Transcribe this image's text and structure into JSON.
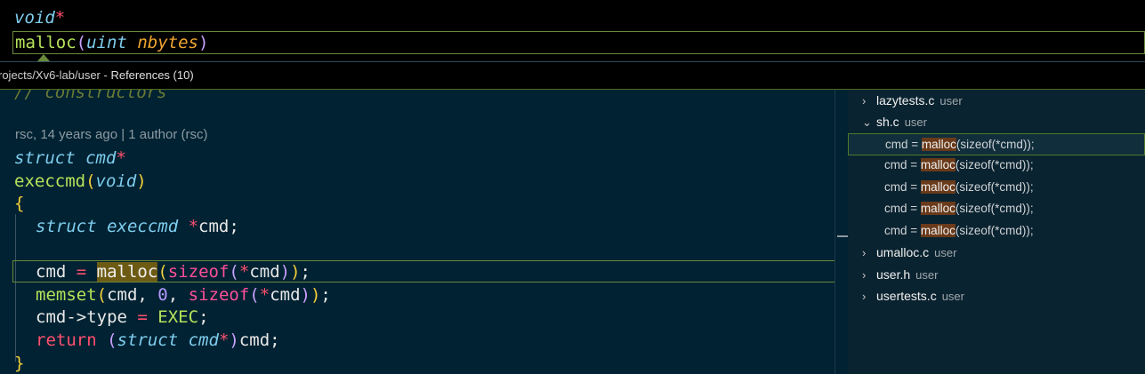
{
  "signature": {
    "return_type": "void",
    "return_ptr": "*",
    "fn_name": "malloc",
    "open_paren": "(",
    "param_type": "uint",
    "param_name": "nbytes",
    "close_paren": ")"
  },
  "peek": {
    "path": "rojects/Xv6-lab/user",
    "separator": " - ",
    "title": "References (10)"
  },
  "code": {
    "cut_line": "// constructors",
    "blame": "rsc, 14 years ago | 1 author (rsc)",
    "lines": {
      "l1_type": "struct cmd",
      "l1_ptr": "*",
      "l2_fn": "execcmd",
      "l2_open": "(",
      "l2_void": "void",
      "l2_close": ")",
      "l3_brace": "{",
      "l4_type": "struct execcmd",
      "l4_star": " *",
      "l4_rest": "cmd;",
      "l6_cmd": "cmd ",
      "l6_eq": "=",
      "l6_space": " ",
      "l6_malloc": "malloc",
      "l6_open": "(",
      "l6_sizeof": "sizeof",
      "l6_open2": "(",
      "l6_star": "*",
      "l6_cmd2": "cmd",
      "l6_close2": ")",
      "l6_close": ")",
      "l6_semi": ";",
      "l7_fn": "memset",
      "l7_open": "(",
      "l7_a": "cmd, ",
      "l7_num": "0",
      "l7_b": ", ",
      "l7_sizeof": "sizeof",
      "l7_open2": "(",
      "l7_star": "*",
      "l7_cmd": "cmd",
      "l7_close2": ")",
      "l7_close": ")",
      "l7_semi": ";",
      "l8_a": "cmd->type ",
      "l8_eq": "=",
      "l8_space": " ",
      "l8_exec": "EXEC",
      "l8_semi": ";",
      "l9_ret": "return",
      "l9_space": " ",
      "l9_open": "(",
      "l9_type": "struct cmd",
      "l9_star": "*",
      "l9_close": ")",
      "l9_rest": "cmd;",
      "l10_brace": "}"
    }
  },
  "references": {
    "files": [
      {
        "chevron": "›",
        "name": "lazytests.c",
        "dir": "user"
      },
      {
        "chevron": "⌄",
        "name": "sh.c",
        "dir": "user"
      },
      {
        "chevron": "›",
        "name": "umalloc.c",
        "dir": "user"
      },
      {
        "chevron": "›",
        "name": "user.h",
        "dir": "user"
      },
      {
        "chevron": "›",
        "name": "usertests.c",
        "dir": "user"
      }
    ],
    "matches": [
      {
        "pre": "cmd = ",
        "match": "malloc",
        "post": "(sizeof(*cmd));"
      },
      {
        "pre": "cmd = ",
        "match": "malloc",
        "post": "(sizeof(*cmd));"
      },
      {
        "pre": "cmd = ",
        "match": "malloc",
        "post": "(sizeof(*cmd));"
      },
      {
        "pre": "cmd = ",
        "match": "malloc",
        "post": "(sizeof(*cmd));"
      },
      {
        "pre": "cmd = ",
        "match": "malloc",
        "post": "(sizeof(*cmd));"
      }
    ]
  },
  "colors": {
    "background": "#002232",
    "peek_background": "#000000",
    "references_background": "#0a2330",
    "highlight_border": "#6a8a3a",
    "match_highlight": "#6a3a1a"
  }
}
